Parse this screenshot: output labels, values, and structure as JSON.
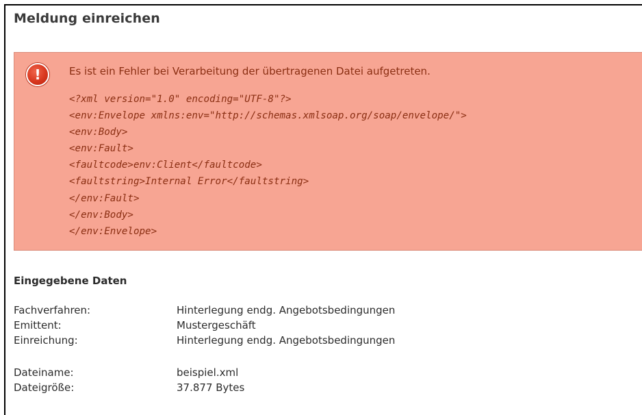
{
  "page": {
    "title": "Meldung einreichen"
  },
  "error": {
    "icon": "exclamation-icon",
    "message": "Es ist ein Fehler bei Verarbeitung der übertragenen Datei aufgetreten.",
    "xml_lines": [
      "<?xml version=\"1.0\" encoding=\"UTF-8\"?>",
      "<env:Envelope xmlns:env=\"http://schemas.xmlsoap.org/soap/envelope/\">",
      "<env:Body>",
      "<env:Fault>",
      "<faultcode>env:Client</faultcode>",
      "<faultstring>Internal Error</faultstring>",
      "</env:Fault>",
      "</env:Body>",
      "</env:Envelope>"
    ],
    "colors": {
      "background": "#f7a593",
      "text": "#8a2e12",
      "icon": "#d8371f"
    }
  },
  "details": {
    "title": "Eingegebene Daten",
    "group1": [
      {
        "label": "Fachverfahren:",
        "value": "Hinterlegung endg. Angebotsbedingungen"
      },
      {
        "label": "Emittent:",
        "value": "Mustergeschäft"
      },
      {
        "label": "Einreichung:",
        "value": "Hinterlegung endg. Angebotsbedingungen"
      }
    ],
    "group2": [
      {
        "label": "Dateiname:",
        "value": "beispiel.xml"
      },
      {
        "label": "Dateigröße:",
        "value": "37.877 Bytes"
      }
    ]
  }
}
